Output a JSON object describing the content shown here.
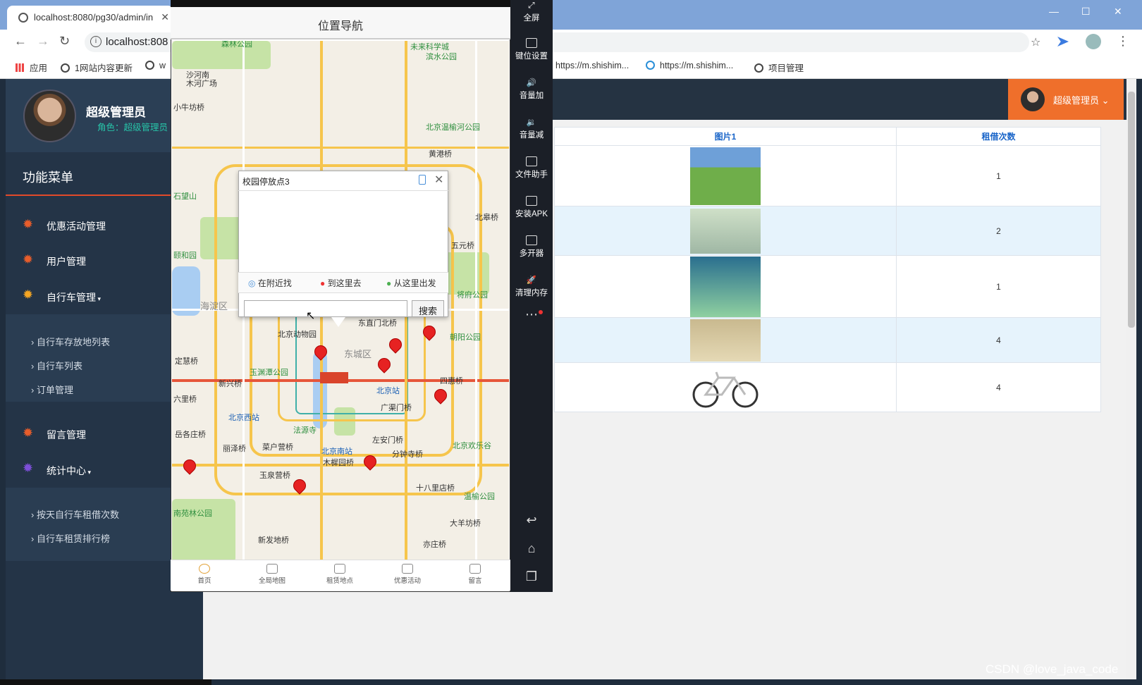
{
  "browser": {
    "tab_title": "localhost:8080/pg30/admin/in",
    "url": "localhost:808",
    "bookmarks": [
      "应用",
      "1网站内容更新",
      "w",
      "https://m.shishim...",
      "https://m.shishim...",
      "项目管理"
    ]
  },
  "admin": {
    "user_name": "超级管理员",
    "role": "角色：超级管理员",
    "topbar_user": "超级管理员",
    "menu_title": "功能菜单",
    "menu": [
      {
        "label": "优惠活动管理"
      },
      {
        "label": "用户管理"
      },
      {
        "label": "自行车管理",
        "subitems": [
          "自行车存放地列表",
          "自行车列表",
          "订单管理"
        ]
      },
      {
        "label": "留言管理"
      },
      {
        "label": "统计中心",
        "subitems": [
          "按天自行车租借次数",
          "自行车租赁排行榜"
        ]
      }
    ],
    "table": {
      "headers": [
        "图片1",
        "租借次数"
      ],
      "rows": [
        {
          "count": "1"
        },
        {
          "count": "2"
        },
        {
          "count": "1"
        },
        {
          "count": "4"
        },
        {
          "count": "4"
        }
      ]
    }
  },
  "phone": {
    "title": "位置导航",
    "popup": {
      "title": "校园停放点3",
      "actions": [
        "在附近找",
        "到这里去",
        "从这里出发"
      ],
      "search_button": "搜索"
    },
    "tabs": [
      "首页",
      "全局地图",
      "租赁地点",
      "优惠活动",
      "留言"
    ],
    "map_labels": [
      "森林公园",
      "未来科学城",
      "滨水公园",
      "沙河南",
      "木河广场",
      "小牛坊桥",
      "北京温榆河公园",
      "黄港桥",
      "石望山",
      "北皋桥",
      "五元桥",
      "颐和园",
      "海淀区",
      "将府公园",
      "北京动物园",
      "东直门北桥",
      "朝阳公园",
      "东城区",
      "定慧桥",
      "玉渊潭公园",
      "新兴桥",
      "北京站",
      "四惠桥",
      "北京西站",
      "广渠门桥",
      "六里桥",
      "岳各庄桥",
      "丽泽桥",
      "菜户营桥",
      "法源寺",
      "北京南站",
      "左安门桥",
      "分钟寺桥",
      "北京欢乐谷",
      "木樨园桥",
      "玉泉营桥",
      "十八里店桥",
      "温榆公园",
      "南苑林公园",
      "新发地桥",
      "大羊坊桥",
      "亦庄桥"
    ]
  },
  "emulator": {
    "buttons": [
      "全屏",
      "键位设置",
      "音量加",
      "音量减",
      "文件助手",
      "安装APK",
      "多开器",
      "清理内存"
    ]
  },
  "watermark": "CSDN @love_java_code"
}
